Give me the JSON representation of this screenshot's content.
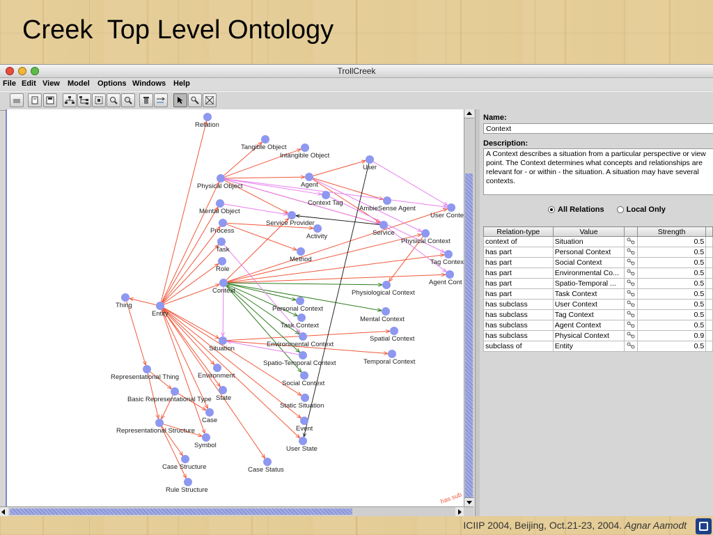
{
  "slide": {
    "title": "Creek  Top Level Ontology",
    "footer_text": "ICIIP 2004, Beijing, Oct.21-23, 2004.",
    "footer_author": "Agnar Aamodt"
  },
  "window": {
    "title": "TrollCreek",
    "menu": [
      "File",
      "Edit",
      "View",
      "Model",
      "Options",
      "Windows",
      "Help"
    ]
  },
  "toolbar": {
    "buttons": [
      "back-icon",
      "new-page-icon",
      "save-icon",
      "hierarchy-icon",
      "tree-icon",
      "frame-icon",
      "zoom-in-icon",
      "zoom-out-icon",
      "delete-icon",
      "link-icon",
      "pointer-icon",
      "search-icon",
      "fit-icon"
    ]
  },
  "graph": {
    "nodes": [
      {
        "id": "relation",
        "label": "Relation"
      },
      {
        "id": "tangible",
        "label": "Tangible Object"
      },
      {
        "id": "intangible",
        "label": "Intangible Object"
      },
      {
        "id": "user",
        "label": "User"
      },
      {
        "id": "physobj",
        "label": "Physical Object"
      },
      {
        "id": "agent",
        "label": "Agent"
      },
      {
        "id": "ctxtag",
        "label": "Context Tag"
      },
      {
        "id": "ambie",
        "label": "AmbieSense Agent"
      },
      {
        "id": "mental",
        "label": "Mental Object"
      },
      {
        "id": "process",
        "label": "Process"
      },
      {
        "id": "servprov",
        "label": "Service Provider"
      },
      {
        "id": "activity",
        "label": "Activity"
      },
      {
        "id": "service",
        "label": "Service"
      },
      {
        "id": "usercont",
        "label": "User Conte"
      },
      {
        "id": "physctx",
        "label": "Physical Context"
      },
      {
        "id": "task",
        "label": "Task"
      },
      {
        "id": "method",
        "label": "Method"
      },
      {
        "id": "tagcont",
        "label": "Tag Contex"
      },
      {
        "id": "role",
        "label": "Role"
      },
      {
        "id": "agentcont",
        "label": "Agent Cont"
      },
      {
        "id": "context",
        "label": "Context"
      },
      {
        "id": "physioctx",
        "label": "Physiological Context"
      },
      {
        "id": "thing",
        "label": "Thing"
      },
      {
        "id": "entity",
        "label": "Entity"
      },
      {
        "id": "persctx",
        "label": "Personal Context"
      },
      {
        "id": "mentctx",
        "label": "Mental Context"
      },
      {
        "id": "taskctx",
        "label": "Task Context"
      },
      {
        "id": "spatctx",
        "label": "Spatial Context"
      },
      {
        "id": "envctx",
        "label": "Environmental Context"
      },
      {
        "id": "situation",
        "label": "Situation"
      },
      {
        "id": "stctx",
        "label": "Spatio-Temporal Context"
      },
      {
        "id": "tempctx",
        "label": "Temporal Context"
      },
      {
        "id": "repthing",
        "label": "Representational Thing"
      },
      {
        "id": "environment",
        "label": "Environment"
      },
      {
        "id": "socctx",
        "label": "Social Context"
      },
      {
        "id": "brt",
        "label": "Basic Representational Type"
      },
      {
        "id": "state",
        "label": "State"
      },
      {
        "id": "statsit",
        "label": "Static Situation"
      },
      {
        "id": "case",
        "label": "Case"
      },
      {
        "id": "event",
        "label": "Event"
      },
      {
        "id": "repstruct",
        "label": "Representational Structure"
      },
      {
        "id": "symbol",
        "label": "Symbol"
      },
      {
        "id": "userstate",
        "label": "User State"
      },
      {
        "id": "casestruct",
        "label": "Case Structure"
      },
      {
        "id": "casestatus",
        "label": "Case Status"
      },
      {
        "id": "rulestruct",
        "label": "Rule Structure"
      }
    ],
    "edges": [
      [
        "entity",
        "thing",
        "sub"
      ],
      [
        "entity",
        "relation",
        "sub"
      ],
      [
        "thing",
        "repthing",
        "sub"
      ],
      [
        "entity",
        "physobj",
        "sub"
      ],
      [
        "entity",
        "mental",
        "sub"
      ],
      [
        "entity",
        "process",
        "sub"
      ],
      [
        "entity",
        "task",
        "sub"
      ],
      [
        "entity",
        "role",
        "sub"
      ],
      [
        "entity",
        "context",
        "sub"
      ],
      [
        "entity",
        "situation",
        "sub"
      ],
      [
        "entity",
        "environment",
        "sub"
      ],
      [
        "entity",
        "state",
        "sub"
      ],
      [
        "entity",
        "case",
        "sub"
      ],
      [
        "entity",
        "symbol",
        "sub"
      ],
      [
        "entity",
        "statsit",
        "sub"
      ],
      [
        "entity",
        "event",
        "sub"
      ],
      [
        "entity",
        "userstate",
        "sub"
      ],
      [
        "entity",
        "casestatus",
        "sub"
      ],
      [
        "physobj",
        "tangible",
        "sub"
      ],
      [
        "physobj",
        "intangible",
        "sub"
      ],
      [
        "physobj",
        "agent",
        "sub"
      ],
      [
        "physobj",
        "servprov",
        "sub"
      ],
      [
        "physobj",
        "service",
        "sub"
      ],
      [
        "agent",
        "user",
        "sub"
      ],
      [
        "agent",
        "ambie",
        "sub"
      ],
      [
        "agent",
        "service",
        "sub"
      ],
      [
        "process",
        "activity",
        "sub"
      ],
      [
        "process",
        "method",
        "sub"
      ],
      [
        "context",
        "usercont",
        "sub"
      ],
      [
        "context",
        "physctx",
        "sub"
      ],
      [
        "context",
        "tagcont",
        "sub"
      ],
      [
        "context",
        "agentcont",
        "sub"
      ],
      [
        "context",
        "servprov",
        "sub"
      ],
      [
        "repthing",
        "brt",
        "sub"
      ],
      [
        "repthing",
        "repstruct",
        "sub"
      ],
      [
        "repstruct",
        "casestruct",
        "sub"
      ],
      [
        "repstruct",
        "rulestruct",
        "sub"
      ],
      [
        "repstruct",
        "symbol",
        "sub"
      ],
      [
        "brt",
        "case",
        "sub"
      ],
      [
        "brt",
        "repstruct",
        "sub"
      ],
      [
        "situation",
        "spatctx",
        "sub"
      ],
      [
        "situation",
        "tempctx",
        "sub"
      ],
      [
        "physctx",
        "physioctx",
        "sub"
      ],
      [
        "context",
        "persctx",
        "part"
      ],
      [
        "context",
        "taskctx",
        "part"
      ],
      [
        "context",
        "envctx",
        "part"
      ],
      [
        "context",
        "stctx",
        "part"
      ],
      [
        "context",
        "socctx",
        "part"
      ],
      [
        "context",
        "physioctx",
        "part"
      ],
      [
        "context",
        "mentctx",
        "part"
      ],
      [
        "physobj",
        "ctxtag",
        "tag"
      ],
      [
        "physobj",
        "usercont",
        "tag"
      ],
      [
        "physobj",
        "service",
        "tag"
      ],
      [
        "user",
        "usercont",
        "tag"
      ],
      [
        "ctxtag",
        "tagcont",
        "tag"
      ],
      [
        "service",
        "agentcont",
        "tag"
      ],
      [
        "task",
        "envctx",
        "tag"
      ],
      [
        "context",
        "situation",
        "tag"
      ],
      [
        "stctx",
        "situation",
        "tag"
      ],
      [
        "mental",
        "servprov",
        "tag"
      ],
      [
        "agent",
        "physctx",
        "tag"
      ],
      [
        "service",
        "servprov",
        "black"
      ],
      [
        "user",
        "userstate",
        "black"
      ]
    ],
    "corner_label": "has sub",
    "colors": {
      "sub": "#f0583a",
      "part": "#2f7d1e",
      "tag": "#e87ef0",
      "black": "#111111",
      "node": "#8e98f0"
    }
  },
  "props": {
    "name_label": "Name:",
    "name_value": "Context",
    "desc_label": "Description:",
    "desc_value": "A Context describes a situation from a particular perspective or view point. The Context determines what concepts and relationships are relevant for - or within - the situation. A situation may have several contexts.",
    "radio_all": "All Relations",
    "radio_local": "Local Only",
    "columns": [
      "Relation-type",
      "Value",
      "",
      "Strength"
    ],
    "rows": [
      {
        "type": "context of",
        "value": "Situation",
        "strength": "0.5"
      },
      {
        "type": "has part",
        "value": "Personal Context",
        "strength": "0.5"
      },
      {
        "type": "has part",
        "value": "Social Context",
        "strength": "0.5"
      },
      {
        "type": "has part",
        "value": "Environmental Co...",
        "strength": "0.5"
      },
      {
        "type": "has part",
        "value": "Spatio-Temporal ...",
        "strength": "0.5"
      },
      {
        "type": "has part",
        "value": "Task Context",
        "strength": "0.5"
      },
      {
        "type": "has subclass",
        "value": "User Context",
        "strength": "0.5"
      },
      {
        "type": "has subclass",
        "value": "Tag Context",
        "strength": "0.5"
      },
      {
        "type": "has subclass",
        "value": "Agent Context",
        "strength": "0.5"
      },
      {
        "type": "has subclass",
        "value": "Physical Context",
        "strength": "0.9"
      },
      {
        "type": "subclass of",
        "value": "Entity",
        "strength": "0.5"
      }
    ]
  }
}
